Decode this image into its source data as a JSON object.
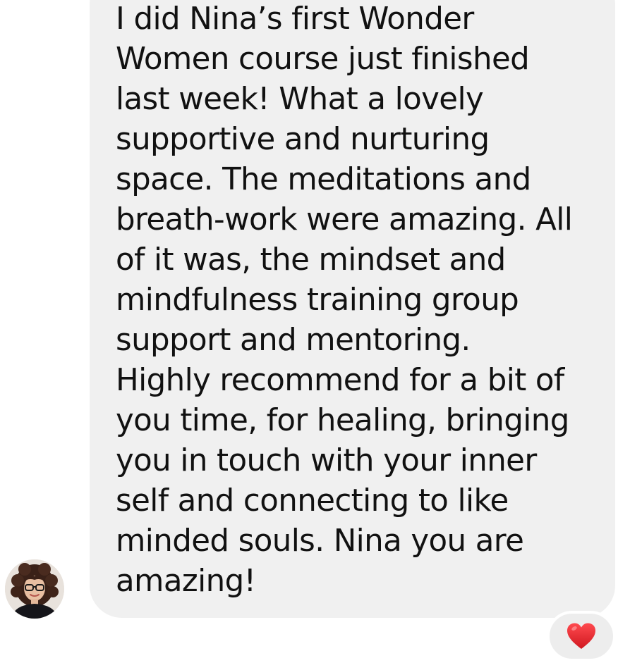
{
  "message": {
    "text": "I did Nina’s first Wonder\nWomen course just finished\nlast week! What a lovely\nsupportive and nurturing\nspace. The meditations and\nbreath-work were amazing. All\nof it was, the mindset and\nmindfulness training group\nsupport and mentoring.\nHighly recommend for a bit of\nyou time, for healing, bringing\nyou in touch with your inner\nself and connecting to like\nminded souls. Nina you are\namazing!",
    "bubble_color": "#f0f0f0",
    "text_color": "#111111"
  },
  "sender": {
    "avatar_icon": "profile-photo"
  },
  "reaction": {
    "icon": "red-heart-icon",
    "color": "#e0242b"
  }
}
